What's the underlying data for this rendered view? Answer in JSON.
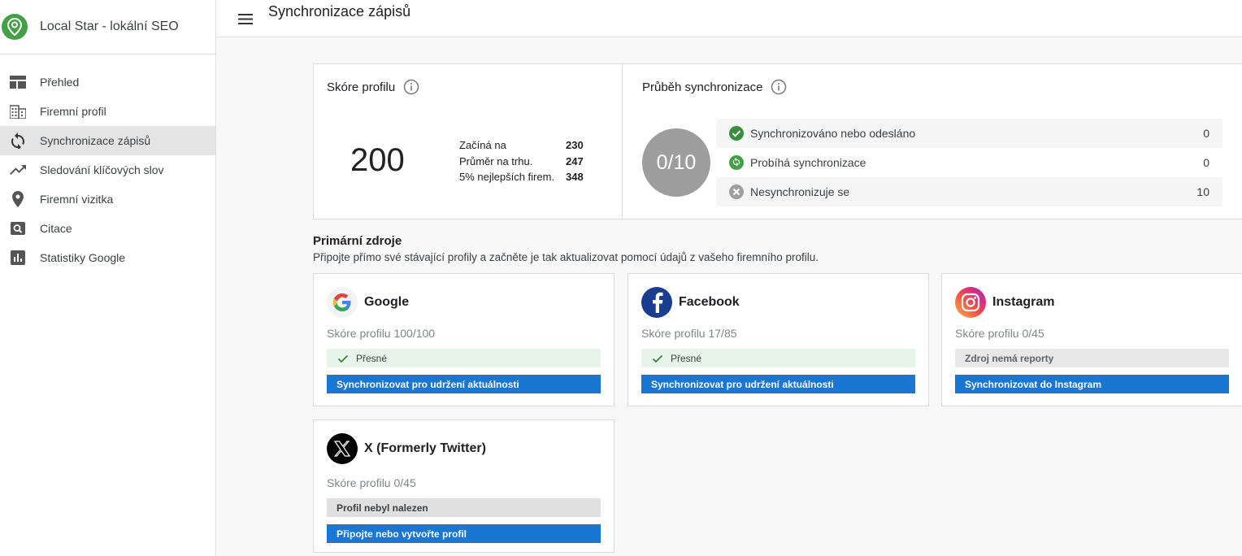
{
  "app": {
    "title": "Local Star - lokální SEO"
  },
  "sidebar": {
    "items": [
      {
        "label": "Přehled",
        "icon": "dashboard-icon"
      },
      {
        "label": "Firemní profil",
        "icon": "building-icon"
      },
      {
        "label": "Synchronizace zápisů",
        "icon": "sync-icon",
        "active": true
      },
      {
        "label": "Sledování klíčových slov",
        "icon": "trending-up-icon"
      },
      {
        "label": "Firemní vizitka",
        "icon": "location-pin-icon"
      },
      {
        "label": "Citace",
        "icon": "search-box-icon"
      },
      {
        "label": "Statistiky Google",
        "icon": "bar-chart-icon"
      }
    ]
  },
  "header": {
    "title": "Synchronizace zápisů"
  },
  "score": {
    "title": "Skóre profilu",
    "value": "200",
    "rows": [
      {
        "label": "Začíná na",
        "value": "230"
      },
      {
        "label": "Průměr na trhu.",
        "value": "247"
      },
      {
        "label": "5% nejlepších firem.",
        "value": "348"
      }
    ]
  },
  "sync": {
    "title": "Průběh synchronizace",
    "circle": "0/10",
    "rows": [
      {
        "label": "Synchronizováno nebo odesláno",
        "count": "0",
        "icon": "check-circle-icon",
        "color": "#388e3c"
      },
      {
        "label": "Probíhá synchronizace",
        "count": "0",
        "icon": "sync-circle-icon",
        "color": "#43a047"
      },
      {
        "label": "Nesynchronizuje se",
        "count": "10",
        "icon": "cancel-circle-icon",
        "color": "#9e9e9e"
      }
    ]
  },
  "primary": {
    "title": "Primární zdroje",
    "subtitle": "Připojte přímo své stávající profily a začněte je tak aktualizovat pomocí údajů z vašeho firemního profilu."
  },
  "sources": [
    {
      "name": "Google",
      "score": "Skóre profilu 100/100",
      "status": "Přesné",
      "status_type": "ok",
      "button": "Synchronizovat pro udržení aktuálnosti"
    },
    {
      "name": "Facebook",
      "score": "Skóre profilu 17/85",
      "status": "Přesné",
      "status_type": "ok",
      "button": "Synchronizovat pro udržení aktuálnosti"
    },
    {
      "name": "Instagram",
      "score": "Skóre profilu 0/45",
      "status": "Zdroj nemá reporty",
      "status_type": "na",
      "button": "Synchronizovat do Instagram"
    },
    {
      "name": "X (Formerly Twitter)",
      "score": "Skóre profilu 0/45",
      "status": "Profil nebyl nalezen",
      "status_type": "miss",
      "button": "Připojte nebo vytvořte profil"
    }
  ],
  "colors": {
    "accent": "#1976d2",
    "brand": "#43a047",
    "ok_bg": "#e6f4ea"
  }
}
